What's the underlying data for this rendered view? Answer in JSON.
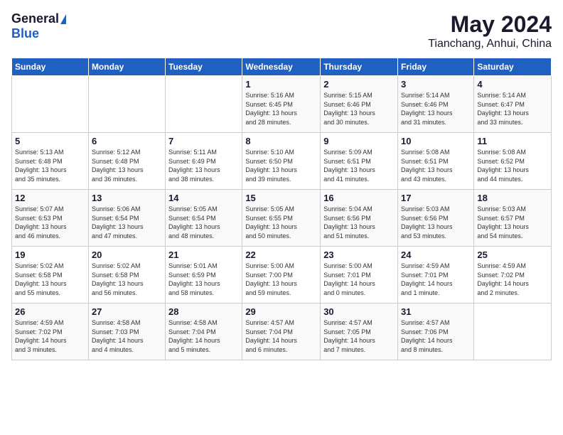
{
  "logo": {
    "general": "General",
    "blue": "Blue"
  },
  "title": "May 2024",
  "subtitle": "Tianchang, Anhui, China",
  "days_of_week": [
    "Sunday",
    "Monday",
    "Tuesday",
    "Wednesday",
    "Thursday",
    "Friday",
    "Saturday"
  ],
  "weeks": [
    [
      {
        "num": "",
        "info": ""
      },
      {
        "num": "",
        "info": ""
      },
      {
        "num": "",
        "info": ""
      },
      {
        "num": "1",
        "info": "Sunrise: 5:16 AM\nSunset: 6:45 PM\nDaylight: 13 hours\nand 28 minutes."
      },
      {
        "num": "2",
        "info": "Sunrise: 5:15 AM\nSunset: 6:46 PM\nDaylight: 13 hours\nand 30 minutes."
      },
      {
        "num": "3",
        "info": "Sunrise: 5:14 AM\nSunset: 6:46 PM\nDaylight: 13 hours\nand 31 minutes."
      },
      {
        "num": "4",
        "info": "Sunrise: 5:14 AM\nSunset: 6:47 PM\nDaylight: 13 hours\nand 33 minutes."
      }
    ],
    [
      {
        "num": "5",
        "info": "Sunrise: 5:13 AM\nSunset: 6:48 PM\nDaylight: 13 hours\nand 35 minutes."
      },
      {
        "num": "6",
        "info": "Sunrise: 5:12 AM\nSunset: 6:48 PM\nDaylight: 13 hours\nand 36 minutes."
      },
      {
        "num": "7",
        "info": "Sunrise: 5:11 AM\nSunset: 6:49 PM\nDaylight: 13 hours\nand 38 minutes."
      },
      {
        "num": "8",
        "info": "Sunrise: 5:10 AM\nSunset: 6:50 PM\nDaylight: 13 hours\nand 39 minutes."
      },
      {
        "num": "9",
        "info": "Sunrise: 5:09 AM\nSunset: 6:51 PM\nDaylight: 13 hours\nand 41 minutes."
      },
      {
        "num": "10",
        "info": "Sunrise: 5:08 AM\nSunset: 6:51 PM\nDaylight: 13 hours\nand 43 minutes."
      },
      {
        "num": "11",
        "info": "Sunrise: 5:08 AM\nSunset: 6:52 PM\nDaylight: 13 hours\nand 44 minutes."
      }
    ],
    [
      {
        "num": "12",
        "info": "Sunrise: 5:07 AM\nSunset: 6:53 PM\nDaylight: 13 hours\nand 46 minutes."
      },
      {
        "num": "13",
        "info": "Sunrise: 5:06 AM\nSunset: 6:54 PM\nDaylight: 13 hours\nand 47 minutes."
      },
      {
        "num": "14",
        "info": "Sunrise: 5:05 AM\nSunset: 6:54 PM\nDaylight: 13 hours\nand 48 minutes."
      },
      {
        "num": "15",
        "info": "Sunrise: 5:05 AM\nSunset: 6:55 PM\nDaylight: 13 hours\nand 50 minutes."
      },
      {
        "num": "16",
        "info": "Sunrise: 5:04 AM\nSunset: 6:56 PM\nDaylight: 13 hours\nand 51 minutes."
      },
      {
        "num": "17",
        "info": "Sunrise: 5:03 AM\nSunset: 6:56 PM\nDaylight: 13 hours\nand 53 minutes."
      },
      {
        "num": "18",
        "info": "Sunrise: 5:03 AM\nSunset: 6:57 PM\nDaylight: 13 hours\nand 54 minutes."
      }
    ],
    [
      {
        "num": "19",
        "info": "Sunrise: 5:02 AM\nSunset: 6:58 PM\nDaylight: 13 hours\nand 55 minutes."
      },
      {
        "num": "20",
        "info": "Sunrise: 5:02 AM\nSunset: 6:58 PM\nDaylight: 13 hours\nand 56 minutes."
      },
      {
        "num": "21",
        "info": "Sunrise: 5:01 AM\nSunset: 6:59 PM\nDaylight: 13 hours\nand 58 minutes."
      },
      {
        "num": "22",
        "info": "Sunrise: 5:00 AM\nSunset: 7:00 PM\nDaylight: 13 hours\nand 59 minutes."
      },
      {
        "num": "23",
        "info": "Sunrise: 5:00 AM\nSunset: 7:01 PM\nDaylight: 14 hours\nand 0 minutes."
      },
      {
        "num": "24",
        "info": "Sunrise: 4:59 AM\nSunset: 7:01 PM\nDaylight: 14 hours\nand 1 minute."
      },
      {
        "num": "25",
        "info": "Sunrise: 4:59 AM\nSunset: 7:02 PM\nDaylight: 14 hours\nand 2 minutes."
      }
    ],
    [
      {
        "num": "26",
        "info": "Sunrise: 4:59 AM\nSunset: 7:02 PM\nDaylight: 14 hours\nand 3 minutes."
      },
      {
        "num": "27",
        "info": "Sunrise: 4:58 AM\nSunset: 7:03 PM\nDaylight: 14 hours\nand 4 minutes."
      },
      {
        "num": "28",
        "info": "Sunrise: 4:58 AM\nSunset: 7:04 PM\nDaylight: 14 hours\nand 5 minutes."
      },
      {
        "num": "29",
        "info": "Sunrise: 4:57 AM\nSunset: 7:04 PM\nDaylight: 14 hours\nand 6 minutes."
      },
      {
        "num": "30",
        "info": "Sunrise: 4:57 AM\nSunset: 7:05 PM\nDaylight: 14 hours\nand 7 minutes."
      },
      {
        "num": "31",
        "info": "Sunrise: 4:57 AM\nSunset: 7:06 PM\nDaylight: 14 hours\nand 8 minutes."
      },
      {
        "num": "",
        "info": ""
      }
    ]
  ]
}
